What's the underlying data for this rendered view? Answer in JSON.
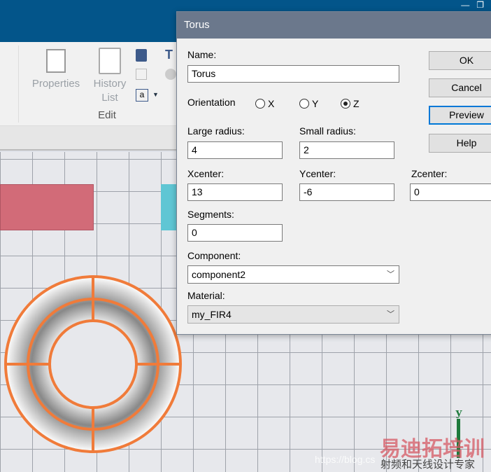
{
  "ribbon": {
    "properties_label": "Properties",
    "history_label": "History",
    "history_label2": "List",
    "group_label": "Edit"
  },
  "dialog": {
    "title": "Torus",
    "name_label": "Name:",
    "name_value": "Torus",
    "orientation_label": "Orientation",
    "orientation_options": [
      "X",
      "Y",
      "Z"
    ],
    "orientation_selected": "Z",
    "large_radius_label": "Large radius:",
    "large_radius_value": "4",
    "small_radius_label": "Small radius:",
    "small_radius_value": "2",
    "xcenter_label": "Xcenter:",
    "xcenter_value": "13",
    "ycenter_label": "Ycenter:",
    "ycenter_value": "-6",
    "zcenter_label": "Zcenter:",
    "zcenter_value": "0",
    "segments_label": "Segments:",
    "segments_value": "0",
    "component_label": "Component:",
    "component_value": "component2",
    "material_label": "Material:",
    "material_value": "my_FIR4",
    "ok": "OK",
    "cancel": "Cancel",
    "preview": "Preview",
    "help": "Help"
  },
  "viewport": {
    "axis_label": "y",
    "axis_color": "#1e7a3c",
    "torus_color": "#f07b3a"
  },
  "watermark": {
    "brand": "易迪拓培训",
    "slogan": "射频和天线设计专家",
    "url": "https://blog.cs"
  }
}
